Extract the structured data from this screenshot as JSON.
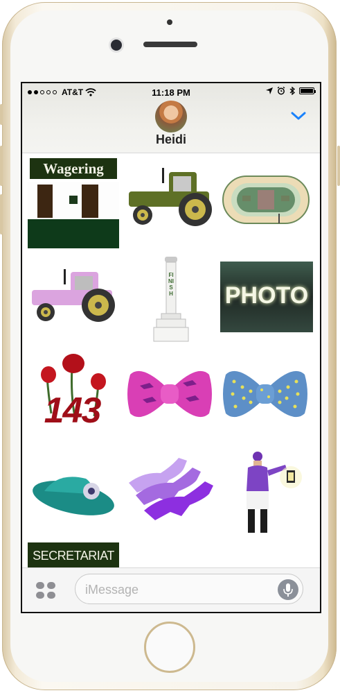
{
  "status_bar": {
    "carrier": "AT&T",
    "time": "11:18 PM",
    "icons": [
      "signal-dots",
      "wifi-icon",
      "location-arrow-icon",
      "alarm-icon",
      "bluetooth-icon",
      "battery-icon"
    ]
  },
  "conversation": {
    "contact_name": "Heidi",
    "expand_icon": "chevron-down-icon"
  },
  "stickers": {
    "wagering_caption": "Wagering",
    "photo_caption": "PHOTO",
    "finish_caption": "FINISH",
    "rose_number": "143",
    "secretariat_caption": "SECRETARIAT"
  },
  "composer": {
    "placeholder": "iMessage",
    "apps_icon": "app-drawer-icon",
    "mic_icon": "microphone-icon"
  },
  "colors": {
    "ios_blue": "#1a82fb",
    "tractor_green": "#5e7026",
    "tractor_pink": "#dba4df",
    "bowtie_pink": "#d93fb5",
    "bowtie_blue": "#5d8fc7",
    "dark_green": "#1d3311"
  }
}
